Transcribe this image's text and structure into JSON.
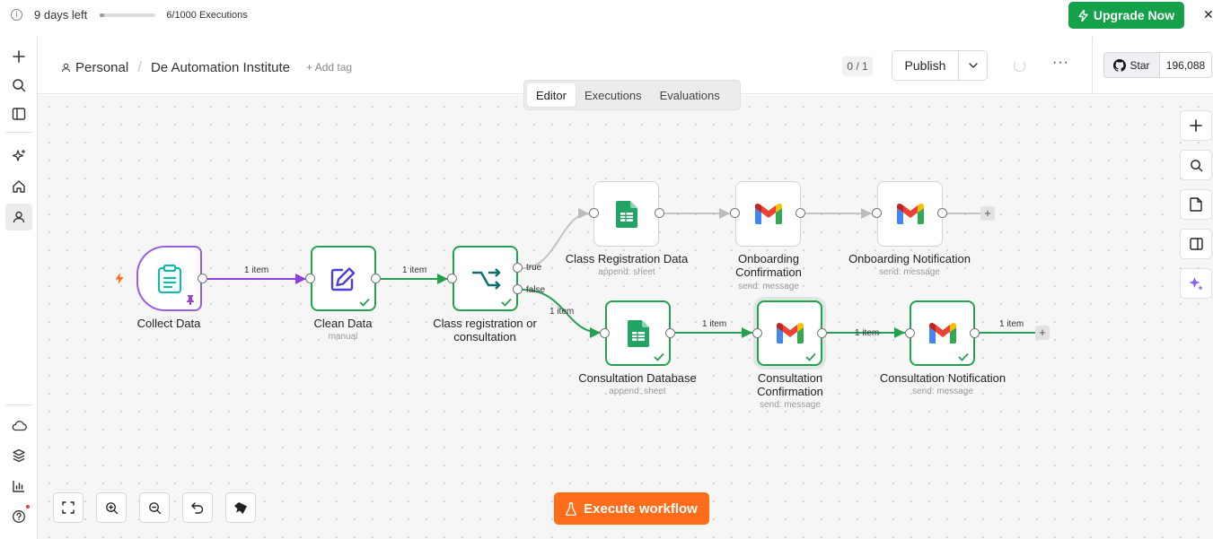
{
  "trial": {
    "days_left": "9 days left",
    "executions": "6/1000 Executions",
    "usage_fraction": 0.006
  },
  "upgrade": {
    "label": "Upgrade Now"
  },
  "header": {
    "breadcrumb_owner": "Personal",
    "workflow_name": "De Automation Institute",
    "add_tag": "+ Add tag",
    "version_badge": "0 / 1",
    "publish_label": "Publish",
    "github_star": "Star",
    "github_count": "196,088"
  },
  "tabs": [
    {
      "label": "Editor",
      "active": true
    },
    {
      "label": "Executions",
      "active": false
    },
    {
      "label": "Evaluations",
      "active": false
    }
  ],
  "nodes": {
    "collect": {
      "label": "Collect Data"
    },
    "clean": {
      "label": "Clean Data",
      "sub": "manual"
    },
    "ifnode": {
      "label": "Class registration or consultation"
    },
    "class_reg": {
      "label": "Class Registration Data",
      "sub": "append: sheet"
    },
    "onb_conf": {
      "label": "Onboarding Confirmation",
      "sub": "send: message"
    },
    "onb_notif": {
      "label": "Onboarding Notification",
      "sub": "send: message"
    },
    "cons_db": {
      "label": "Consultation Database",
      "sub": "append: sheet"
    },
    "cons_conf": {
      "label": "Consultation Confirmation",
      "sub": "send: message"
    },
    "cons_notif": {
      "label": "Consultation Notification",
      "sub": "send: message"
    }
  },
  "edges": {
    "e1": "1 item",
    "e2": "1 item",
    "true_branch": "true",
    "false_branch": "false",
    "e3": "1 item",
    "e4": "1 item",
    "e5": "1 item",
    "e6": "1 item"
  },
  "execute": {
    "label": "Execute workflow"
  },
  "colors": {
    "success": "#24a150",
    "trigger": "#9b5de0",
    "execute": "#ff6d1a",
    "upgrade": "#14a14a"
  }
}
